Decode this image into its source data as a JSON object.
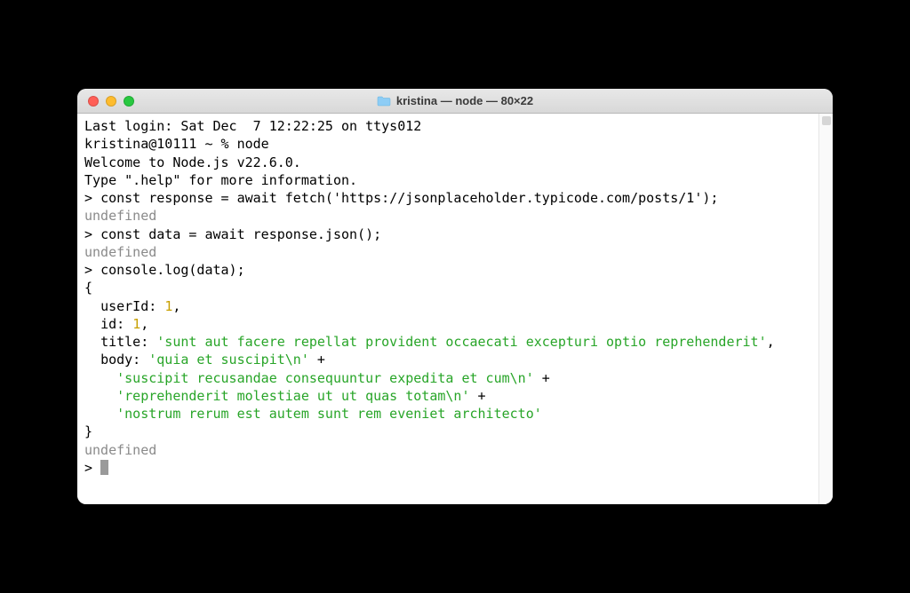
{
  "window": {
    "title": "kristina — node — 80×22"
  },
  "terminal": {
    "last_login": "Last login: Sat Dec  7 12:22:25 on ttys012",
    "shell_prompt_line": "kristina@10111 ~ % node",
    "welcome": "Welcome to Node.js v22.6.0.",
    "help_hint": "Type \".help\" for more information.",
    "repl_prompt": "> ",
    "cmd1": "const response = await fetch('https://jsonplaceholder.typicode.com/posts/1');",
    "undef": "undefined",
    "cmd2": "const data = await response.json();",
    "cmd3": "console.log(data);",
    "obj_open": "{",
    "line_userId_key": "  userId: ",
    "line_userId_val": "1",
    "comma": ",",
    "line_id_key": "  id: ",
    "line_id_val": "1",
    "line_title_key": "  title: ",
    "line_title_val": "'sunt aut facere repellat provident occaecati excepturi optio reprehenderit'",
    "line_body_key": "  body: ",
    "body_seg1": "'quia et suscipit\\n'",
    "plus": " +",
    "body_seg2": "    'suscipit recusandae consequuntur expedita et cum\\n'",
    "body_seg3": "    'reprehenderit molestiae ut ut quas totam\\n'",
    "body_seg4": "    'nostrum rerum est autem sunt rem eveniet architecto'",
    "obj_close": "}"
  }
}
